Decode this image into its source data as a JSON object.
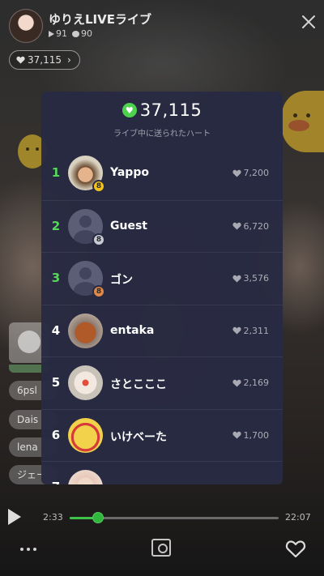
{
  "header": {
    "host_name": "ゆりえLIVEライブ",
    "plays": "91",
    "comments": "90",
    "heart_count": "37,115"
  },
  "chat": {
    "items": [
      "6psl",
      "Dais",
      "lena",
      "ジェー"
    ]
  },
  "ranking": {
    "total_hearts": "37,115",
    "caption": "ライブ中に送られたハート",
    "rows": [
      {
        "rank": "1",
        "name": "Yappo",
        "hearts": "7,200",
        "medal": "gold",
        "medal_text": "8",
        "avatar": "yappo"
      },
      {
        "rank": "2",
        "name": "Guest",
        "hearts": "6,720",
        "medal": "silver",
        "medal_text": "8",
        "avatar": "default"
      },
      {
        "rank": "3",
        "name": "ゴン",
        "hearts": "3,576",
        "medal": "bronze",
        "medal_text": "8",
        "avatar": "default"
      },
      {
        "rank": "4",
        "name": "entaka",
        "hearts": "2,311",
        "medal": "",
        "medal_text": "",
        "avatar": "entaka"
      },
      {
        "rank": "5",
        "name": "さとこここ",
        "hearts": "2,169",
        "medal": "",
        "medal_text": "",
        "avatar": "satoko"
      },
      {
        "rank": "6",
        "name": "いけべーた",
        "hearts": "1,700",
        "medal": "",
        "medal_text": "",
        "avatar": "ikebe"
      },
      {
        "rank": "7",
        "name": "",
        "hearts": "",
        "medal": "",
        "medal_text": "",
        "avatar": "seven"
      }
    ]
  },
  "player": {
    "current_time": "2:33",
    "total_time": "22:07",
    "progress": 0.137
  },
  "colors": {
    "accent_green": "#56d85a",
    "panel_bg": "#282a42",
    "medal_gold": "#f2c21b"
  }
}
